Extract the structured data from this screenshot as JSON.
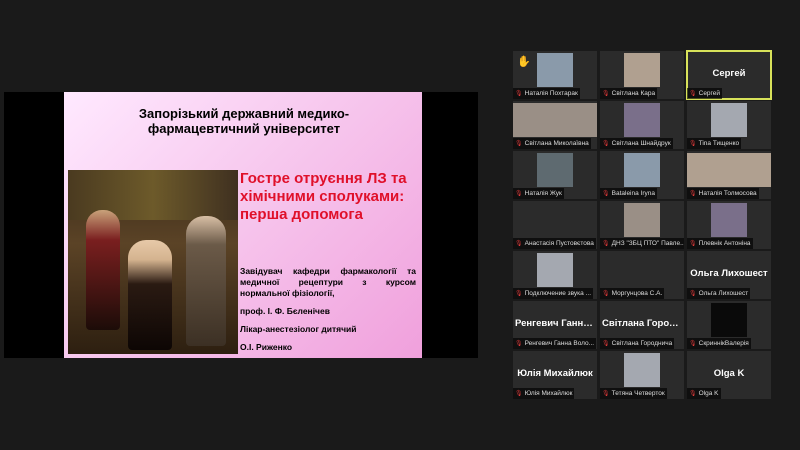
{
  "slide": {
    "title": "Запорізький державний медико-фармацевтичний університет",
    "heading": "Гостре отруєння ЛЗ та хімічними сполуками: перша допомога",
    "body1": "Завідувач кафедри фармакології та медичної рецептури з курсом нормальної фізіології,",
    "body2": "проф. І. Ф. Бєленічев",
    "body3": "Лікар-анестезіолог дитячий",
    "body4": "О.І. Риженко"
  },
  "participants": [
    {
      "caption": "Наталія Похтарак",
      "name_display": "",
      "video": true,
      "hand": true
    },
    {
      "caption": "Світлана Кара",
      "name_display": "",
      "video": true
    },
    {
      "caption": "Сергей",
      "name_display": "Сергей",
      "video": false,
      "speaking": true
    },
    {
      "caption": "Світлана Миколаївна",
      "name_display": "",
      "video": true
    },
    {
      "caption": "Світлана Шнайдрук",
      "name_display": "",
      "video": true
    },
    {
      "caption": "Tina Тищенко",
      "name_display": "",
      "video": true
    },
    {
      "caption": "Наталія Жук",
      "name_display": "",
      "video": true
    },
    {
      "caption": "Bataleina Iryna",
      "name_display": "",
      "video": true
    },
    {
      "caption": "Наталія Толмосова",
      "name_display": "",
      "video": true
    },
    {
      "caption": "Анастасія Пустовєтова",
      "name_display": "",
      "video": false
    },
    {
      "caption": "ДНЗ \"ЗБЦ ПТО\" Павле...",
      "name_display": "",
      "video": true
    },
    {
      "caption": "Плевнік Антоніна",
      "name_display": "",
      "video": true
    },
    {
      "caption": "Подключение звука ...",
      "name_display": "",
      "video": true
    },
    {
      "caption": "Моргунцова С.А.",
      "name_display": "",
      "video": false
    },
    {
      "caption": "Ольга Лихошест",
      "name_display": "Ольга Лихошест",
      "video": false
    },
    {
      "caption": "Ренгевич Ганна Воло...",
      "name_display": "Ренгевич Ганна...",
      "video": false
    },
    {
      "caption": "Світлана Городнича",
      "name_display": "Світлана Город...",
      "video": false
    },
    {
      "caption": "СкриннікВалерія",
      "name_display": "",
      "video": true,
      "dark": true
    },
    {
      "caption": "Юлія Михайлюк",
      "name_display": "Юлія Михайлюк",
      "video": false
    },
    {
      "caption": "Тетяна Четверток",
      "name_display": "",
      "video": true
    },
    {
      "caption": "Olga K",
      "name_display": "Olga K",
      "video": false
    }
  ],
  "colors": {
    "heading": "#e0102a",
    "speaking": "#d8e25a",
    "mic_muted": "#e03a3a"
  },
  "icons": {
    "mic_muted": "mic-muted-icon",
    "raised_hand": "raised-hand-icon"
  }
}
